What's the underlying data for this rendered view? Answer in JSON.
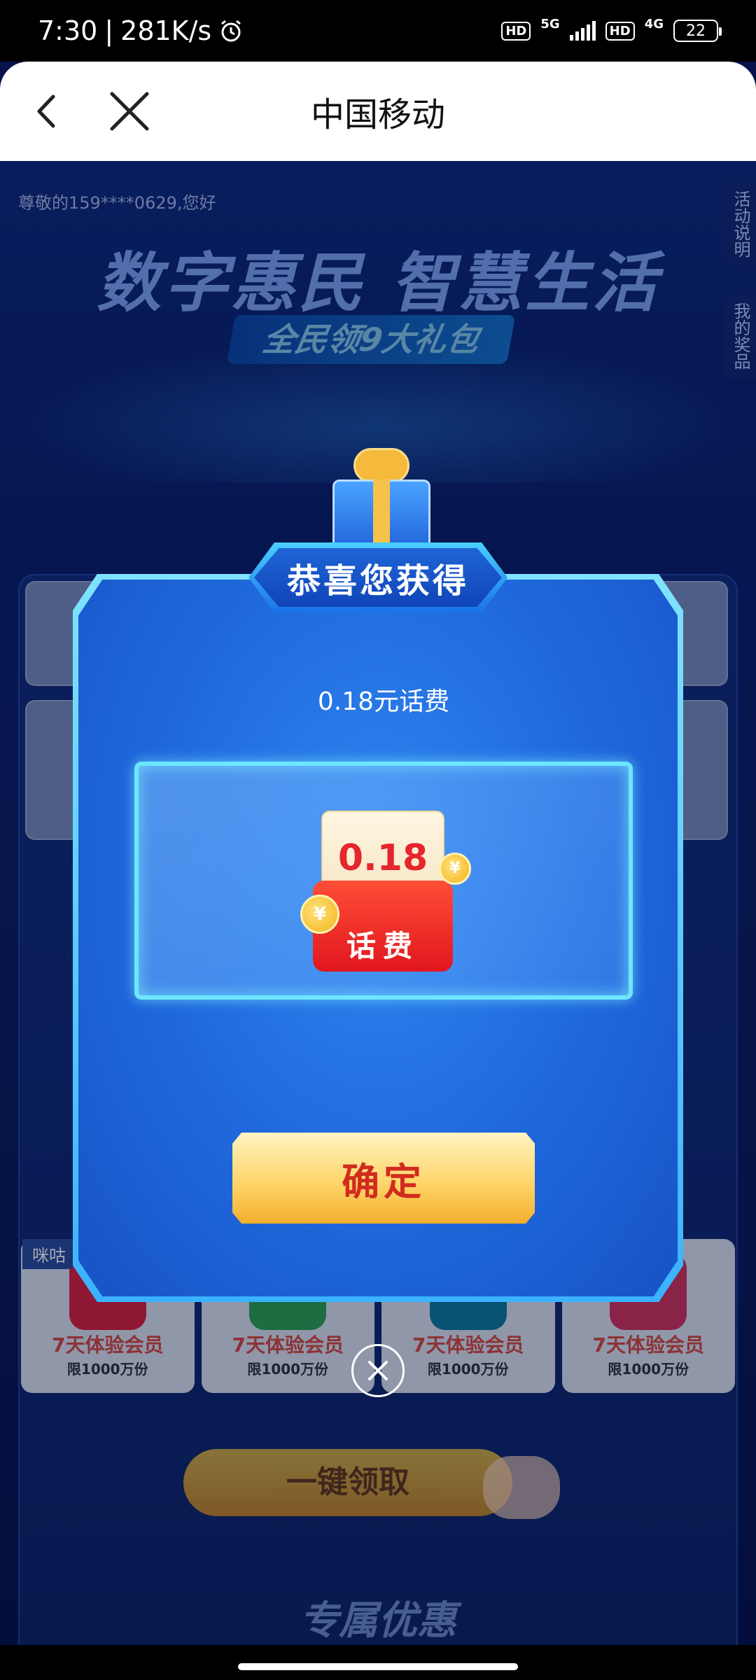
{
  "status_bar": {
    "time": "7:30",
    "speed": "281K/s",
    "network_1": "5G",
    "network_2": "4G",
    "hd": "HD",
    "battery": "22"
  },
  "nav": {
    "title": "中国移动"
  },
  "page": {
    "greeting": "尊敬的159****0629,您好",
    "side_tabs": [
      "活动说明",
      "我的奖品"
    ],
    "hero_title": "数字惠民 智慧生活",
    "hero_subtitle": "全民领9大礼包",
    "member_cards": [
      {
        "line1": "7天体验会员",
        "line2": "限1000万份",
        "color": "#e8213a"
      },
      {
        "line1": "7天体验会员",
        "line2": "限1000万份",
        "color": "#2fa84f"
      },
      {
        "line1": "7天体验会员",
        "line2": "限1000万份",
        "color": "#0d7fa0"
      },
      {
        "line1": "7天体验会员",
        "line2": "限1000万份",
        "color": "#e0335a"
      }
    ],
    "migu_tag": "咪咕",
    "grab_button": "一键领取",
    "bottom_title": "专属优惠"
  },
  "modal": {
    "title": "恭喜您获得",
    "prize_text": "0.18元话费",
    "coupon_amount": "0.18",
    "coupon_label": "话费",
    "coin_symbol": "¥",
    "confirm_button": "确定"
  }
}
